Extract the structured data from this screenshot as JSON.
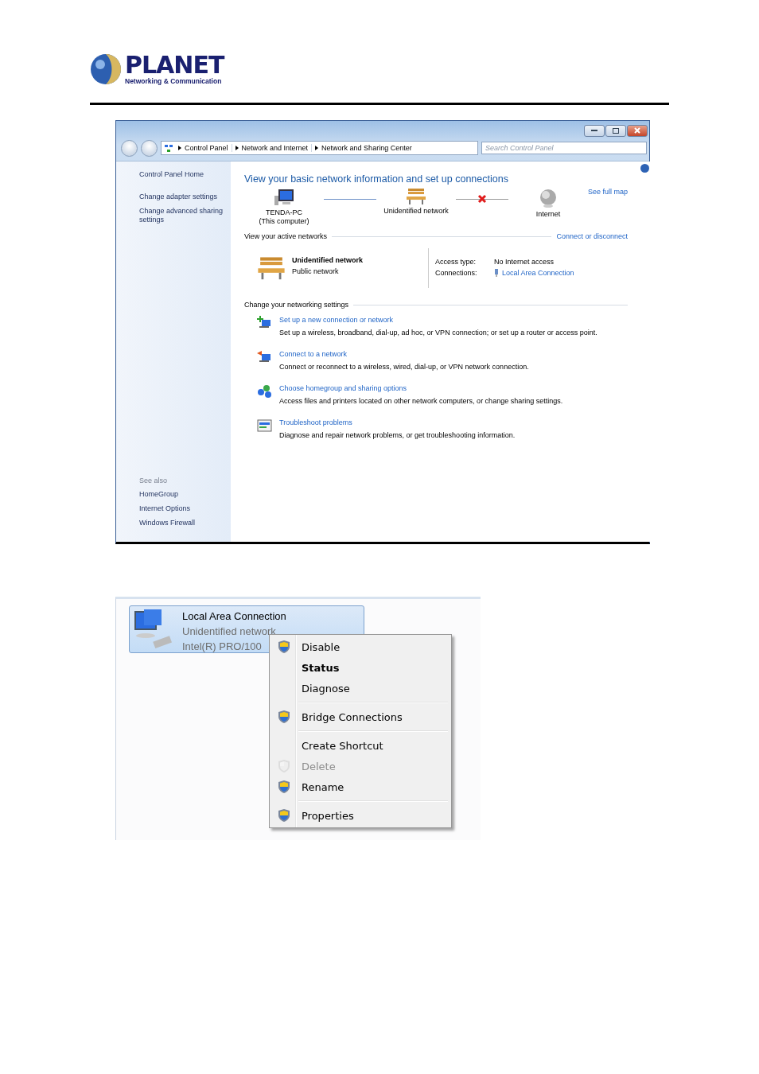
{
  "brand": {
    "name": "PLANET",
    "tagline": "Networking & Communication"
  },
  "window": {
    "breadcrumbs": [
      "Control Panel",
      "Network and Internet",
      "Network and Sharing Center"
    ],
    "search": {
      "placeholder": "Search Control Panel"
    },
    "sidebar": {
      "items": [
        {
          "label": "Control Panel Home"
        },
        {
          "label": "Change adapter settings"
        },
        {
          "label": "Change advanced sharing settings"
        }
      ],
      "see_also": {
        "title": "See also",
        "items": [
          "HomeGroup",
          "Internet Options",
          "Windows Firewall"
        ]
      }
    },
    "heading": "View your basic network information and set up connections",
    "map": {
      "nodes": [
        {
          "kind": "computer",
          "name": "TENDA-PC",
          "note": "(This computer)"
        },
        {
          "kind": "bench",
          "name": "Unidentified network"
        },
        {
          "kind": "globe",
          "name": "Internet"
        }
      ],
      "links": [
        {
          "broken": false
        },
        {
          "broken": true
        }
      ],
      "see_full_map": "See full map"
    },
    "active": {
      "title": "View your active networks",
      "link": "Connect or disconnect",
      "network": "Unidentified network",
      "type": "Public network",
      "access_label": "Access type:",
      "access_value": "No Internet access",
      "connections_label": "Connections:",
      "connections_value": "Local Area Connection"
    },
    "settings": {
      "title": "Change your networking settings",
      "tasks": [
        {
          "kind": "new",
          "title": "Set up a new connection or network",
          "desc": "Set up a wireless, broadband, dial-up, ad hoc, or VPN connection; or set up a router or access point."
        },
        {
          "kind": "connect",
          "title": "Connect to a network",
          "desc": "Connect or reconnect to a wireless, wired, dial-up, or VPN network connection."
        },
        {
          "kind": "homegroup",
          "title": "Choose homegroup and sharing options",
          "desc": "Access files and printers located on other network computers, or change sharing settings."
        },
        {
          "kind": "troubleshoot",
          "title": "Troubleshoot problems",
          "desc": "Diagnose and repair network problems, or get troubleshooting information."
        }
      ]
    }
  },
  "adapter": {
    "name": "Local Area Connection",
    "status": "Unidentified network",
    "device": "Intel(R) PRO/100",
    "selected": true
  },
  "context_menu": [
    {
      "kind": "item",
      "label": "Disable",
      "shield": true,
      "bold": false,
      "disabled": false
    },
    {
      "kind": "item",
      "label": "Status",
      "shield": false,
      "bold": true,
      "disabled": false
    },
    {
      "kind": "item",
      "label": "Diagnose",
      "shield": false,
      "bold": false,
      "disabled": false
    },
    {
      "kind": "separator"
    },
    {
      "kind": "item",
      "label": "Bridge Connections",
      "shield": true,
      "bold": false,
      "disabled": false
    },
    {
      "kind": "separator"
    },
    {
      "kind": "item",
      "label": "Create Shortcut",
      "shield": false,
      "bold": false,
      "disabled": false
    },
    {
      "kind": "item",
      "label": "Delete",
      "shield": true,
      "bold": false,
      "disabled": true
    },
    {
      "kind": "item",
      "label": "Rename",
      "shield": true,
      "bold": false,
      "disabled": false
    },
    {
      "kind": "separator"
    },
    {
      "kind": "item",
      "label": "Properties",
      "shield": true,
      "bold": false,
      "disabled": false
    }
  ]
}
